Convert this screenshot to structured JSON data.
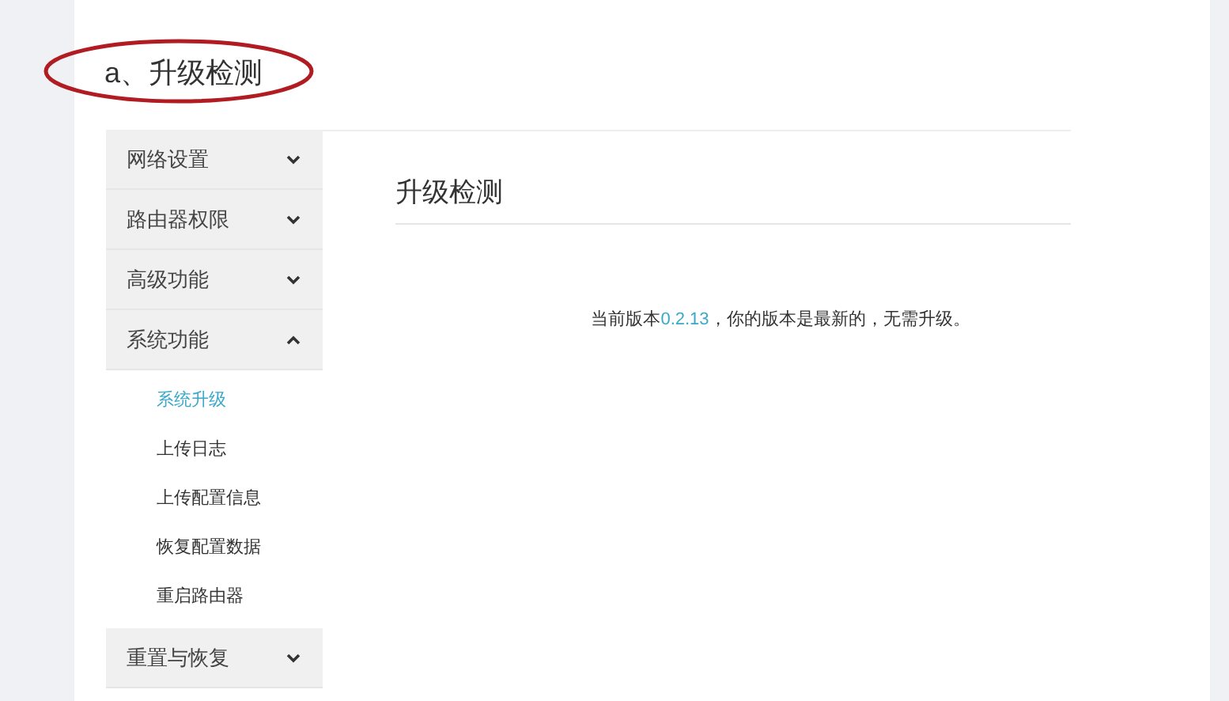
{
  "heading": "a、升级检测",
  "sidebar": {
    "groups": [
      {
        "label": "网络设置",
        "expanded": false
      },
      {
        "label": "路由器权限",
        "expanded": false
      },
      {
        "label": "高级功能",
        "expanded": false
      },
      {
        "label": "系统功能",
        "expanded": true,
        "children": [
          {
            "label": "系统升级",
            "selected": true
          },
          {
            "label": "上传日志",
            "selected": false
          },
          {
            "label": "上传配置信息",
            "selected": false
          },
          {
            "label": "恢复配置数据",
            "selected": false
          },
          {
            "label": "重启路由器",
            "selected": false
          }
        ]
      },
      {
        "label": "重置与恢复",
        "expanded": false
      }
    ]
  },
  "panel": {
    "title": "升级检测",
    "message": {
      "before": "当前版本",
      "version": "0.2.13",
      "after": "，你的版本是最新的，无需升级。"
    }
  }
}
